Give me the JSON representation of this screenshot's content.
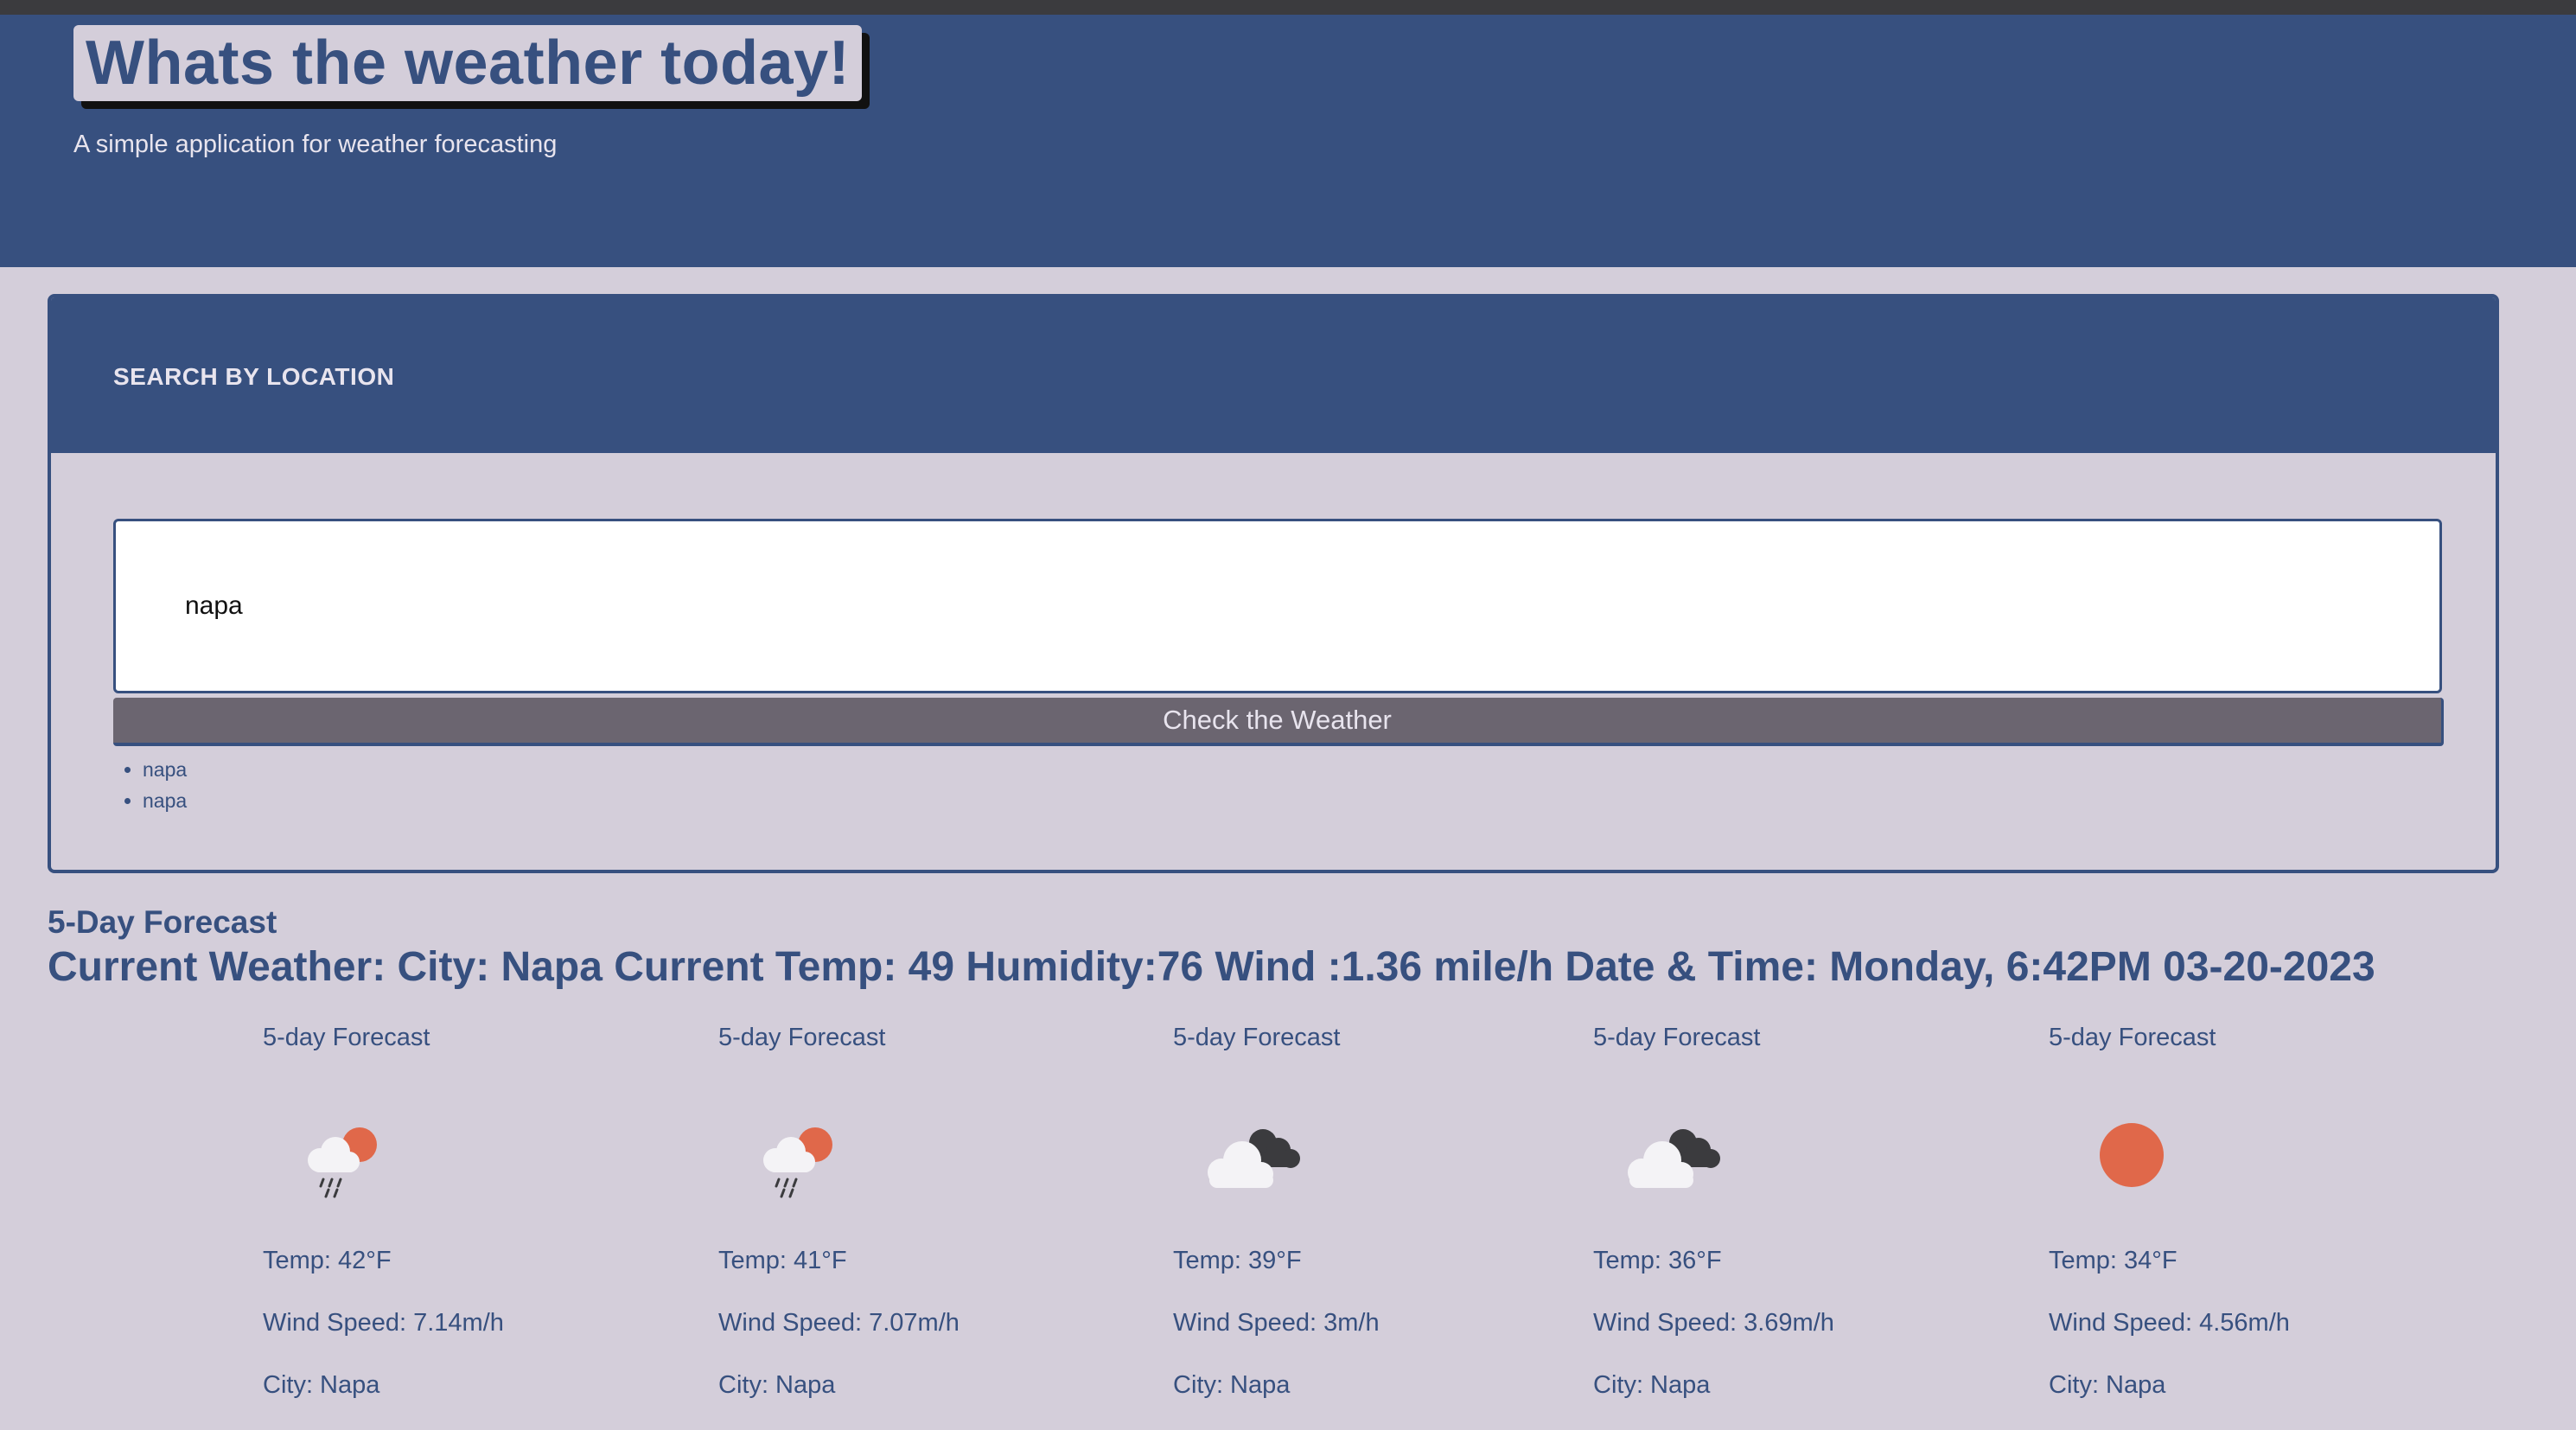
{
  "app": {
    "title": "Whats the weather today!",
    "subtitle": "A simple application for weather forecasting"
  },
  "search": {
    "heading": "SEARCH BY LOCATION",
    "input_value": "napa",
    "button_label": "Check the Weather",
    "history": [
      "napa",
      "napa"
    ]
  },
  "forecast_heading": "5-Day Forecast",
  "current_weather": "Current Weather: City: Napa Current Temp: 49 Humidity:76 Wind :1.36 mile/h Date & Time: Monday, 6:42PM 03-20-2023",
  "cards": [
    {
      "title": "5-day Forecast",
      "icon": "rain-sun-icon",
      "temp": "Temp: 42°F",
      "wind": "Wind Speed: 7.14m/h",
      "city": "City: Napa"
    },
    {
      "title": "5-day Forecast",
      "icon": "rain-sun-icon",
      "temp": "Temp: 41°F",
      "wind": "Wind Speed: 7.07m/h",
      "city": "City: Napa"
    },
    {
      "title": "5-day Forecast",
      "icon": "broken-clouds-icon",
      "temp": "Temp: 39°F",
      "wind": "Wind Speed: 3m/h",
      "city": "City: Napa"
    },
    {
      "title": "5-day Forecast",
      "icon": "broken-clouds-icon",
      "temp": "Temp: 36°F",
      "wind": "Wind Speed: 3.69m/h",
      "city": "City: Napa"
    },
    {
      "title": "5-day Forecast",
      "icon": "clear-sun-icon",
      "temp": "Temp: 34°F",
      "wind": "Wind Speed: 4.56m/h",
      "city": "City: Napa"
    }
  ],
  "colors": {
    "primary": "#37507f",
    "background": "#d4ceda",
    "button": "#6b6570",
    "sun": "#e0684a"
  }
}
